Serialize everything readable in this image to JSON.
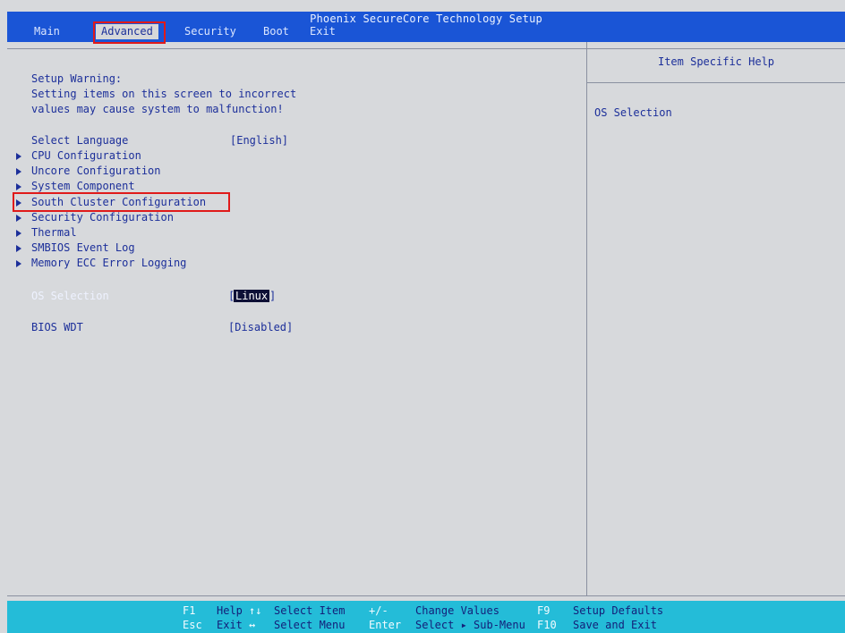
{
  "title": "Phoenix SecureCore Technology Setup",
  "menu": {
    "main": "Main",
    "advanced": "Advanced",
    "security": "Security",
    "boot": "Boot",
    "exit": "Exit"
  },
  "warning": {
    "line1": "Setup Warning:",
    "line2": "Setting items on this screen to incorrect",
    "line3": "values may cause system to malfunction!"
  },
  "language": {
    "label": "Select Language",
    "value": "[English]"
  },
  "submenus": {
    "cpu": "CPU Configuration",
    "uncore": "Uncore Configuration",
    "system": "System Component",
    "south": "South Cluster Configuration",
    "security": "Security Configuration",
    "thermal": "Thermal",
    "smbios": "SMBIOS Event Log",
    "memory": "Memory ECC Error Logging"
  },
  "os_selection": {
    "label": "OS Selection",
    "value": "Linux",
    "open": "[",
    "close": "]"
  },
  "bios_wdt": {
    "label": "BIOS WDT",
    "value": "[Disabled]"
  },
  "help": {
    "header": "Item Specific Help",
    "text": "OS Selection"
  },
  "keys": {
    "f1": "F1",
    "help": "Help",
    "arrows_ud": "↑↓",
    "select_item": "Select Item",
    "plusminus": "+/-",
    "change_values": "Change Values",
    "f9": "F9",
    "setup_defaults": "Setup Defaults",
    "esc": "Esc",
    "exit": "Exit",
    "arrows_lr": "↔",
    "select_menu": "Select Menu",
    "enter": "Enter",
    "select_submenu": "Select ▸ Sub-Menu",
    "f10": "F10",
    "save_exit": "Save and Exit"
  }
}
